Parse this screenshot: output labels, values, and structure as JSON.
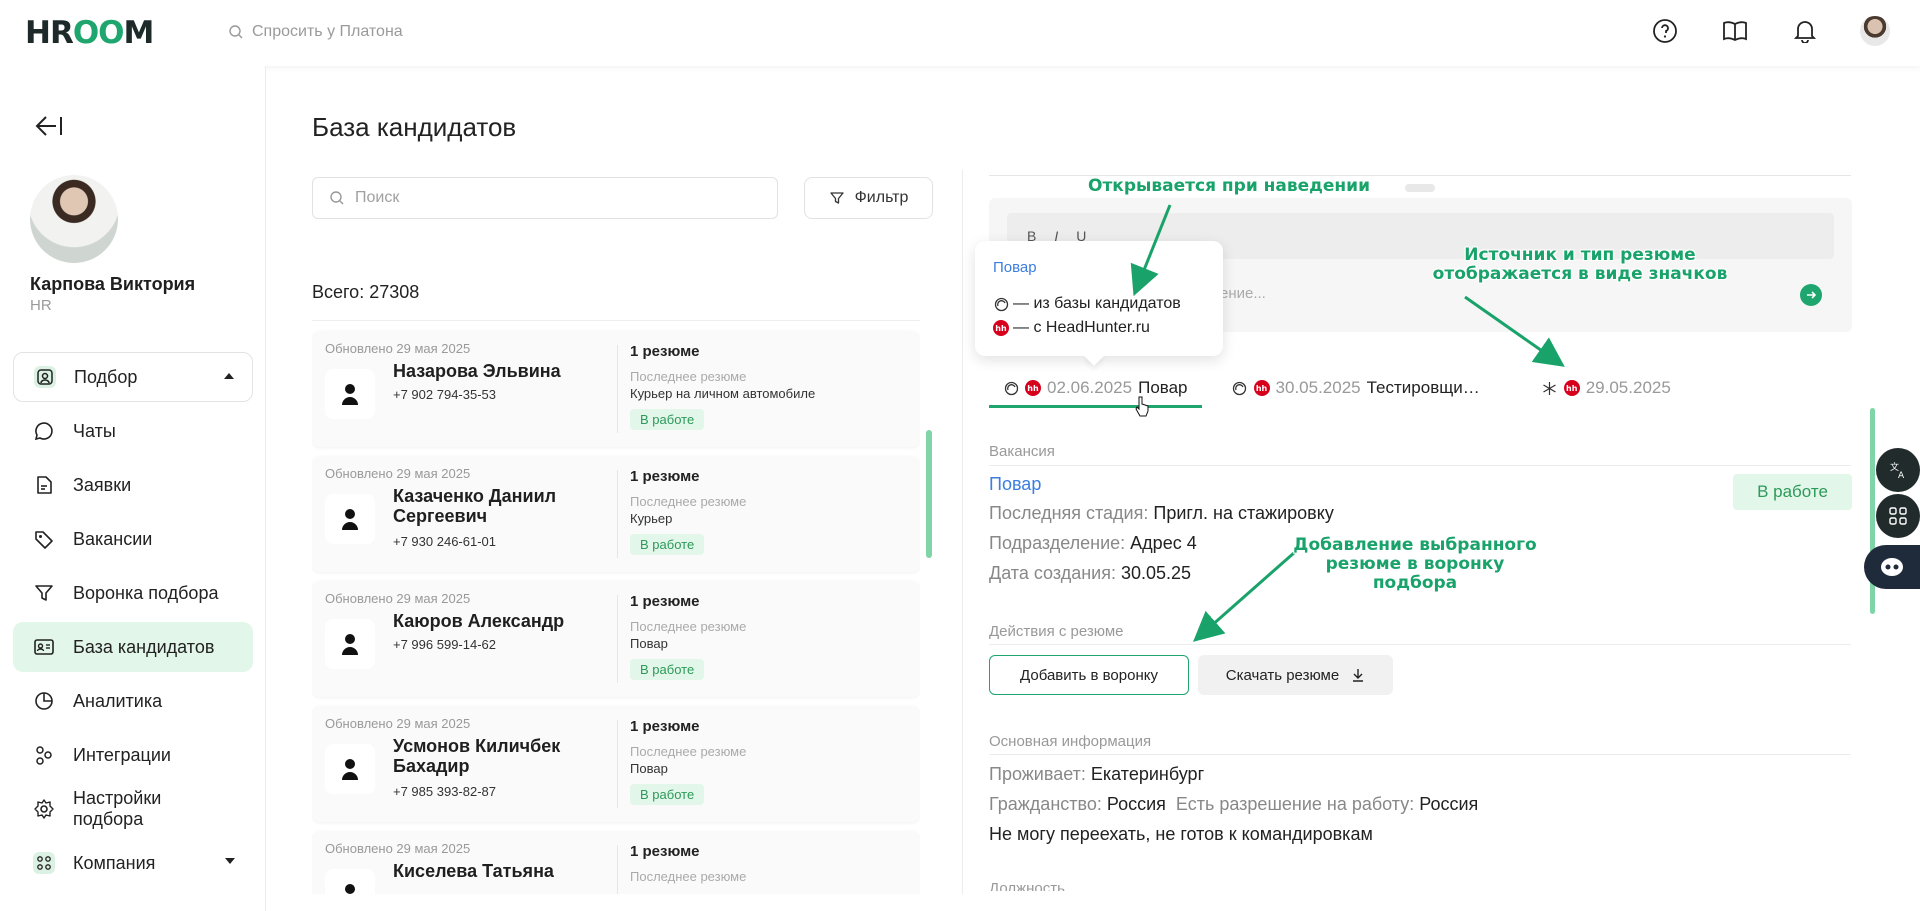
{
  "header": {
    "logo": {
      "pre": "HR",
      "oo": "OO",
      "post": "M"
    },
    "search_placeholder": "Спросить у Платона"
  },
  "sidebar": {
    "user": {
      "name": "Карпова Виктория",
      "role": "HR"
    },
    "items": [
      {
        "label": "Подбор",
        "icon": "user-square-icon"
      },
      {
        "label": "Чаты",
        "icon": "chat-icon"
      },
      {
        "label": "Заявки",
        "icon": "document-icon"
      },
      {
        "label": "Вакансии",
        "icon": "tag-icon"
      },
      {
        "label": "Воронка подбора",
        "icon": "funnel-icon"
      },
      {
        "label": "База кандидатов",
        "icon": "id-card-icon"
      },
      {
        "label": "Аналитика",
        "icon": "pie-chart-icon"
      },
      {
        "label": "Интеграции",
        "icon": "integrations-icon"
      },
      {
        "label": "Настройки подбора",
        "icon": "gear-icon"
      },
      {
        "label": "Компания",
        "icon": "company-icon"
      }
    ]
  },
  "main": {
    "title": "База кандидатов",
    "search_placeholder": "Поиск",
    "filter_label": "Фильтр",
    "total": "Всего: 27308",
    "candidates": [
      {
        "updated": "Обновлено 29 мая 2025",
        "name": "Назарова Эльвина",
        "phone": "+7 902 794-35-53",
        "resumes": "1 резюме",
        "last_label": "Последнее резюме",
        "last_title": "Курьер на личном автомобиле",
        "status": "В работе"
      },
      {
        "updated": "Обновлено 29 мая 2025",
        "name": "Казаченко Даниил Сергеевич",
        "phone": "+7 930 246-61-01",
        "resumes": "1 резюме",
        "last_label": "Последнее резюме",
        "last_title": "Курьер",
        "status": "В работе"
      },
      {
        "updated": "Обновлено 29 мая 2025",
        "name": "Каюров Александр",
        "phone": "+7 996 599-14-62",
        "resumes": "1 резюме",
        "last_label": "Последнее резюме",
        "last_title": "Повар",
        "status": "В работе"
      },
      {
        "updated": "Обновлено 29 мая 2025",
        "name": "Усмонов Киличбек Бахадир",
        "phone": "+7 985 393-82-87",
        "resumes": "1 резюме",
        "last_label": "Последнее резюме",
        "last_title": "Повар",
        "status": "В работе"
      },
      {
        "updated": "Обновлено 29 мая 2025",
        "name": "Киселева Татьяна",
        "phone": "",
        "resumes": "1 резюме",
        "last_label": "Последнее резюме",
        "last_title": "",
        "status": ""
      }
    ]
  },
  "detail": {
    "editor": {
      "bold": "B",
      "italic": "I",
      "underline": "U",
      "placeholder": "ение..."
    },
    "tooltip": {
      "title": "Повар",
      "row1": "— из базы кандидатов",
      "row2": "— с HeadHunter.ru"
    },
    "tabs": [
      {
        "date": "02.06.2025",
        "title": "Повар"
      },
      {
        "date": "30.05.2025",
        "title": "Тестировщи…"
      },
      {
        "date": "29.05.2025",
        "title": ""
      }
    ],
    "vacancy_label": "Вакансия",
    "vacancy_link": "Повар",
    "vacancy_status": "В работе",
    "last_stage_k": "Последняя стадия:",
    "last_stage_v": " Пригл. на стажировку",
    "division_k": "Подразделение:",
    "division_v": " Адрес 4",
    "created_k": "Дата создания:",
    "created_v": " 30.05.25",
    "actions_label": "Действия с резюме",
    "add_to_funnel": "Добавить в воронку",
    "download": "Скачать резюме",
    "basic_label": "Основная информация",
    "lives_k": "Проживает:",
    "lives_v": " Екатеринбург",
    "citizen_k": "Гражданство:",
    "citizen_v": " Россия",
    "permit_k": "Есть разрешение на работу:",
    "permit_v": " Россия",
    "relocation": "Не могу переехать, не готов к командировкам",
    "position_label": "Должность"
  },
  "annotations": {
    "hover": "Открывается при наведении",
    "icons": "Источник и тип резюме отображается в виде значков",
    "funnel": "Добавление выбранного резюме в воронку подбора"
  },
  "colors": {
    "accent": "#1ea66e",
    "link": "#3b7de0",
    "badge_bg": "#e3f6ea",
    "hh_red": "#d6001c"
  }
}
